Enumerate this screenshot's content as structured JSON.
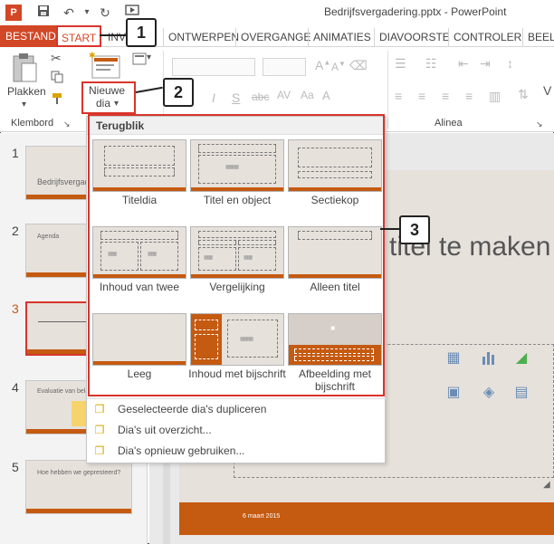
{
  "window": {
    "title": "Bedrijfsvergadering.pptx - PowerPoint",
    "app_icon": "P"
  },
  "qat": {
    "save_icon": "floppy-icon",
    "undo_icon": "undo-icon",
    "redo_icon": "redo-icon"
  },
  "tabs": [
    {
      "label": "BESTAND"
    },
    {
      "label": "START"
    },
    {
      "label": "INVO"
    },
    {
      "label": "ONTWERPEN"
    },
    {
      "label": "OVERGANGE"
    },
    {
      "label": "ANIMATIES"
    },
    {
      "label": "DIAVOORSTE"
    },
    {
      "label": "CONTROLER"
    },
    {
      "label": "BEELD"
    }
  ],
  "ribbon": {
    "paste_label": "Plakken",
    "new_slide_label_1": "Nieuwe",
    "new_slide_label_2": "dia",
    "new_slide_arrow": "▾",
    "clipboard_group": "Klembord",
    "paragraph_group": "Alinea"
  },
  "gallery": {
    "header": "Terugblik",
    "layouts": [
      {
        "label": "Titeldia"
      },
      {
        "label": "Titel en object"
      },
      {
        "label": "Sectiekop"
      },
      {
        "label": "Inhoud van twee"
      },
      {
        "label": "Vergelijking"
      },
      {
        "label": "Alleen titel"
      },
      {
        "label": "Leeg"
      },
      {
        "label": "Inhoud met bijschrift"
      },
      {
        "label": "Afbeelding met bijschrift"
      }
    ],
    "menu": [
      {
        "label": "Geselecteerde dia's dupliceren"
      },
      {
        "label": "Dia's uit overzicht..."
      },
      {
        "label": "Dia's opnieuw gebruiken..."
      }
    ]
  },
  "thumbnails": [
    {
      "number": "1",
      "text": "Bedrijfsvergad"
    },
    {
      "number": "2",
      "text": "Agenda"
    },
    {
      "number": "3",
      "text": ""
    },
    {
      "number": "4",
      "text": "Evaluatie van belangrijke"
    },
    {
      "number": "5",
      "text": "Hoe hebben we gepresteerd?"
    }
  ],
  "slide": {
    "title_text": "titel te maken",
    "date": "6 maart 2015"
  },
  "callouts": {
    "one": "1",
    "two": "2",
    "three": "3"
  },
  "colors": {
    "accent": "#d24726",
    "slide_bar": "#c55a11",
    "highlight": "#d8342b"
  }
}
